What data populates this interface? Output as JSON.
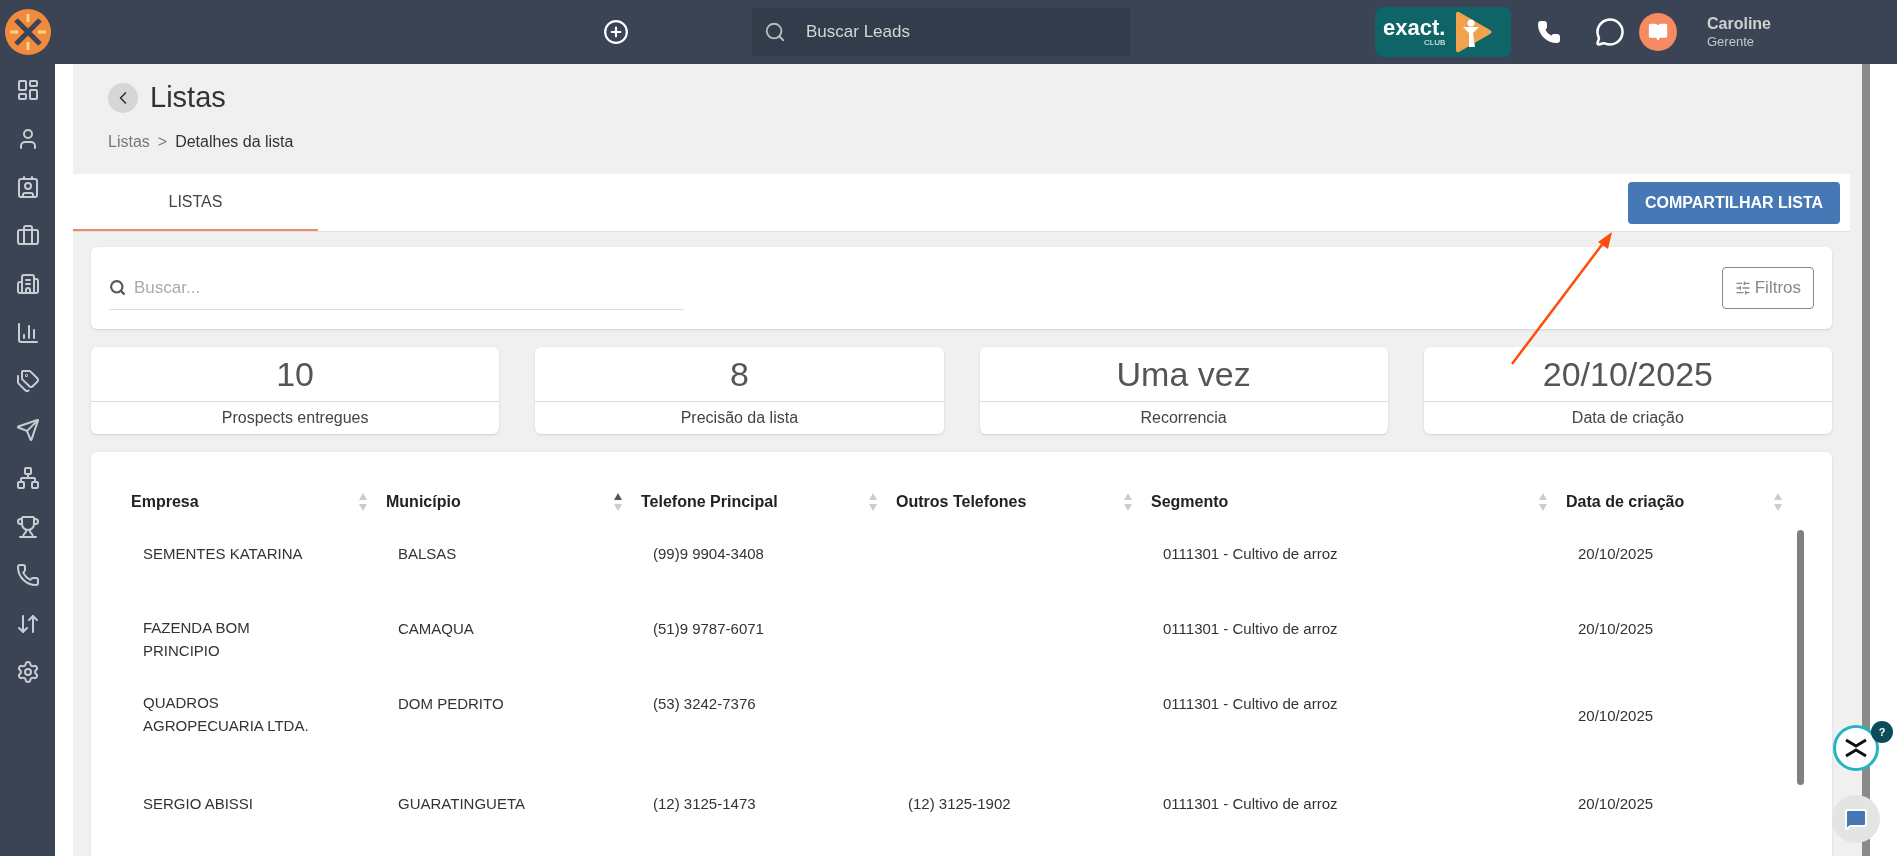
{
  "topbar": {
    "search": {
      "placeholder": "Buscar Leads"
    },
    "brand": {
      "word": "exact.",
      "sub": "CLUB"
    },
    "user": {
      "name": "Caroline",
      "role": "Gerente"
    }
  },
  "page": {
    "title": "Listas",
    "breadcrumb_separator": ">",
    "breadcrumb": [
      {
        "label": "Listas",
        "current": false
      },
      {
        "label": "Detalhes da lista",
        "current": true
      }
    ]
  },
  "tabs": [
    {
      "label": "LISTAS",
      "selected": true
    }
  ],
  "share_button": "COMPARTILHAR LISTA",
  "search": {
    "placeholder": "Buscar..."
  },
  "filters_button": "Filtros",
  "stats": [
    {
      "value": "10",
      "label": "Prospects entregues"
    },
    {
      "value": "8",
      "label": "Precisão da lista"
    },
    {
      "value": "Uma vez",
      "label": "Recorrencia"
    },
    {
      "value": "20/10/2025",
      "label": "Data de criação"
    }
  ],
  "table": {
    "columns": [
      {
        "label": "Empresa",
        "sorted": false
      },
      {
        "label": "Município",
        "sorted": true
      },
      {
        "label": "Telefone Principal",
        "sorted": false
      },
      {
        "label": "Outros Telefones",
        "sorted": false
      },
      {
        "label": "Segmento",
        "sorted": false
      },
      {
        "label": "Data de criação",
        "sorted": false
      }
    ],
    "rows": [
      [
        "SEMENTES KATARINA",
        "BALSAS",
        "(99)9 9904-3408",
        "",
        "0111301 - Cultivo de arroz",
        "20/10/2025"
      ],
      [
        "FAZENDA BOM PRINCIPIO",
        "CAMAQUA",
        "(51)9 9787-6071",
        "",
        "0111301 - Cultivo de arroz",
        "20/10/2025"
      ],
      [
        "QUADROS AGROPECUARIA LTDA.",
        "DOM PEDRITO",
        "(53) 3242-7376",
        "",
        "0111301 - Cultivo de arroz",
        "20/10/2025"
      ],
      [
        "SERGIO ABISSI",
        "GUARATINGUETA",
        "(12) 3125-1473",
        "(12) 3125-1902",
        "0111301 - Cultivo de arroz",
        "20/10/2025"
      ]
    ]
  },
  "help_badge": "?"
}
